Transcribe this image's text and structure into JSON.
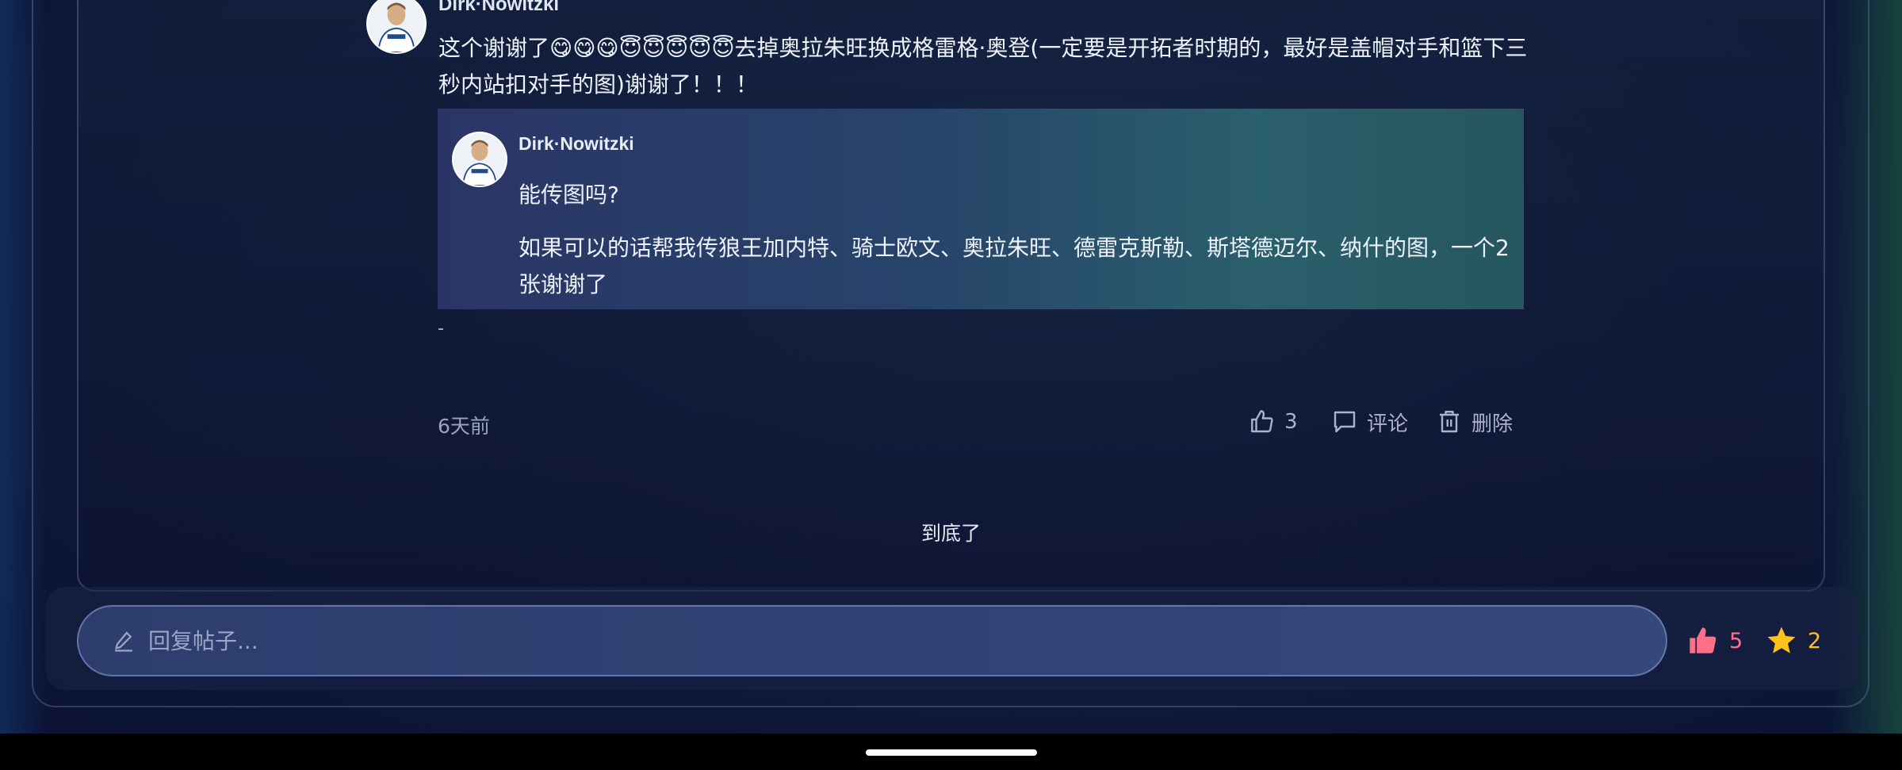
{
  "post": {
    "author": "Dirk·Nowitzki",
    "text": "这个谢谢了😋😋😋😇😇😇😇😇去掉奥拉朱旺换成格雷格·奥登(一定要是开拓者时期的，最好是盖帽对手和篮下三秒内站扣对手的图)谢谢了！！！",
    "quote": {
      "author": "Dirk·Nowitzki",
      "line1": "能传图吗?",
      "line2": "如果可以的话帮我传狼王加内特、骑士欧文、奥拉朱旺、德雷克斯勒、斯塔德迈尔、纳什的图，一个2张谢谢了"
    },
    "dash": "-",
    "timestamp": "6天前",
    "actions": {
      "like_count": "3",
      "comment_label": "评论",
      "delete_label": "删除"
    }
  },
  "end_text": "到底了",
  "reply": {
    "placeholder": "回复帖子..."
  },
  "stats": {
    "likes": "5",
    "stars": "2"
  },
  "colors": {
    "like_accent": "#ff6f87",
    "star_accent": "#ffc21a",
    "background": "#101a3a"
  },
  "icons": {
    "like": "thumbs-up-icon",
    "comment": "comment-icon",
    "delete": "trash-icon",
    "pencil": "pencil-icon",
    "liked": "thumbs-up-filled-icon",
    "star": "star-icon"
  }
}
